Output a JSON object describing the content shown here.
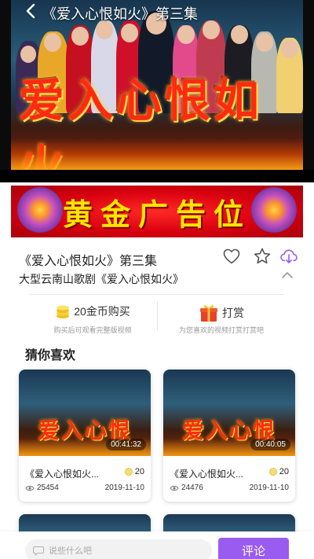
{
  "header": {
    "title": "《爱入心恨如火》第三集"
  },
  "player": {
    "poster_art_text": "爱入心恨如火"
  },
  "ad": {
    "text": "黄金广告位"
  },
  "info": {
    "title": "《爱入心恨如火》第三集",
    "subtitle": "大型云南山歌剧《爱入心恨如火》"
  },
  "actions": {
    "buy": {
      "label": "20金币购买",
      "hint": "购买后可观看完整版视频",
      "icon": "coin-stack-icon"
    },
    "reward": {
      "label": "打赏",
      "hint": "为您喜欢的视频打赏打赏吧",
      "icon": "gift-box-icon"
    }
  },
  "recommend": {
    "title": "猜你喜欢",
    "items": [
      {
        "thumb_text": "爱入心恨",
        "duration": "00:41:32",
        "title": "《爱入心恨如火...",
        "coins": "20",
        "views": "25454",
        "date": "2019-11-10"
      },
      {
        "thumb_text": "爱入心恨",
        "duration": "00:40:05",
        "title": "《爱入心恨如火...",
        "coins": "20",
        "views": "24476",
        "date": "2019-11-10"
      }
    ]
  },
  "comment": {
    "placeholder": "说些什么吧",
    "button_label": "评论"
  },
  "colors": {
    "accent": "#9a5bf0",
    "ad_red": "#d8000f",
    "ad_yellow": "#ffe400"
  }
}
